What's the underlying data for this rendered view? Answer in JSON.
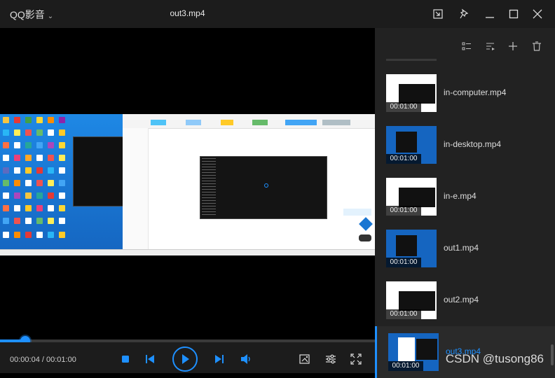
{
  "app": {
    "name": "QQ影音",
    "file_title": "out3.mp4"
  },
  "player": {
    "time_display": "00:00:04 / 00:01:00",
    "progress_fraction": 0.067
  },
  "playlist": {
    "items": [
      {
        "name": "in-computer.mp4",
        "duration": "00:01:00",
        "thumb": "white"
      },
      {
        "name": "in-desktop.mp4",
        "duration": "00:01:00",
        "thumb": "blue"
      },
      {
        "name": "in-e.mp4",
        "duration": "00:01:00",
        "thumb": "white"
      },
      {
        "name": "out1.mp4",
        "duration": "00:01:00",
        "thumb": "blue"
      },
      {
        "name": "out2.mp4",
        "duration": "00:01:00",
        "thumb": "white"
      },
      {
        "name": "out3.mp4",
        "duration": "00:01:00",
        "thumb": "blue",
        "active": true
      }
    ]
  },
  "watermark": "CSDN @tusong86",
  "colors": {
    "accent": "#1e90ff",
    "background": "#1c1c1c",
    "panel": "#222222"
  }
}
